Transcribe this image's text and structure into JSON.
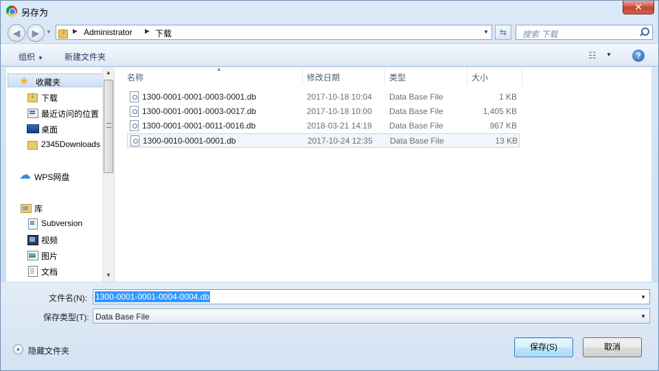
{
  "window": {
    "title": "另存为",
    "close_glyph": "✕"
  },
  "navbar": {
    "back_glyph": "◀",
    "forward_glyph": "▶",
    "breadcrumb": [
      "Administrator",
      "下载"
    ],
    "search_placeholder": "搜索 下载"
  },
  "toolbar": {
    "organize": "组织",
    "new_folder": "新建文件夹",
    "help": "?"
  },
  "sidebar": {
    "items": [
      {
        "label": "收藏夹",
        "icon": "star-icon"
      },
      {
        "label": "下载",
        "icon": "downloads-folder-icon"
      },
      {
        "label": "最近访问的位置",
        "icon": "recent-places-icon"
      },
      {
        "label": "桌面",
        "icon": "desktop-icon"
      },
      {
        "label": "2345Downloads",
        "icon": "folder-icon"
      },
      {
        "label": "WPS网盘",
        "icon": "cloud-icon"
      },
      {
        "label": "库",
        "icon": "library-icon"
      },
      {
        "label": "Subversion",
        "icon": "subversion-icon"
      },
      {
        "label": "视频",
        "icon": "video-icon"
      },
      {
        "label": "图片",
        "icon": "pictures-icon"
      },
      {
        "label": "文档",
        "icon": "documents-icon"
      }
    ]
  },
  "filelist": {
    "columns": [
      "名称",
      "修改日期",
      "类型",
      "大小"
    ],
    "rows": [
      {
        "name": "1300-0001-0001-0003-0001.db",
        "date": "2017-10-18 10:04",
        "type": "Data Base File",
        "size": "1 KB"
      },
      {
        "name": "1300-0001-0001-0003-0017.db",
        "date": "2017-10-18 10:00",
        "type": "Data Base File",
        "size": "1,405 KB"
      },
      {
        "name": "1300-0001-0001-0011-0016.db",
        "date": "2018-03-21 14:19",
        "type": "Data Base File",
        "size": "967 KB"
      },
      {
        "name": "1300-0010-0001-0001.db",
        "date": "2017-10-24 12:35",
        "type": "Data Base File",
        "size": "13 KB"
      }
    ]
  },
  "form": {
    "filename_label": "文件名(N):",
    "filename_value": "1300-0001-0001-0004-0004.db",
    "filetype_label": "保存类型(T):",
    "filetype_value": "Data Base File",
    "hide_folders": "隐藏文件夹",
    "save": "保存(S)",
    "cancel": "取消"
  },
  "colors": {
    "selection": "#3399ff",
    "accent": "#3b6db0",
    "close": "#c7452e"
  }
}
